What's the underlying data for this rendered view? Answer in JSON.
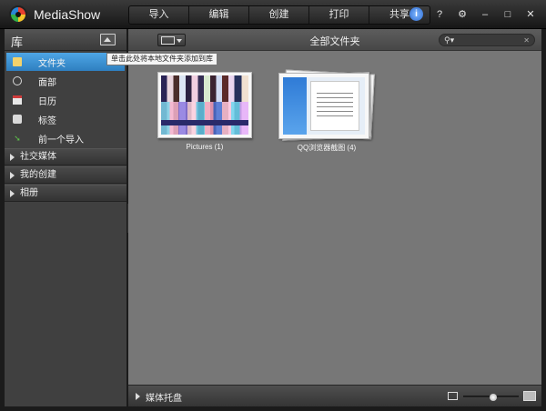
{
  "app": {
    "title": "MediaShow"
  },
  "menu": [
    "导入",
    "编辑",
    "创建",
    "打印",
    "共享"
  ],
  "titlebar": {
    "help_label": "?",
    "settings_icon": "gear-icon",
    "minimize_label": "–",
    "maximize_label": "□",
    "close_label": "✕"
  },
  "library": {
    "title": "库",
    "add_folder_tooltip": "单击此处将本地文件夹添加到库",
    "items": [
      {
        "label": "文件夹",
        "icon": "folder-icon",
        "active": true
      },
      {
        "label": "面部",
        "icon": "face-icon",
        "active": false
      },
      {
        "label": "日历",
        "icon": "calendar-icon",
        "active": false
      },
      {
        "label": "标签",
        "icon": "tag-icon",
        "active": false
      },
      {
        "label": "前一个导入",
        "icon": "import-arrow-icon",
        "active": false
      }
    ],
    "sections": [
      "社交媒体",
      "我的创建",
      "相册"
    ]
  },
  "main": {
    "breadcrumb": "全部文件夹",
    "search_placeholder": "",
    "thumbnails": [
      {
        "label": "Pictures (1)"
      },
      {
        "label": "QQ浏览器截图 (4)"
      }
    ]
  },
  "bottom": {
    "tray_label": "媒体托盘",
    "zoom_level": 0.55
  }
}
